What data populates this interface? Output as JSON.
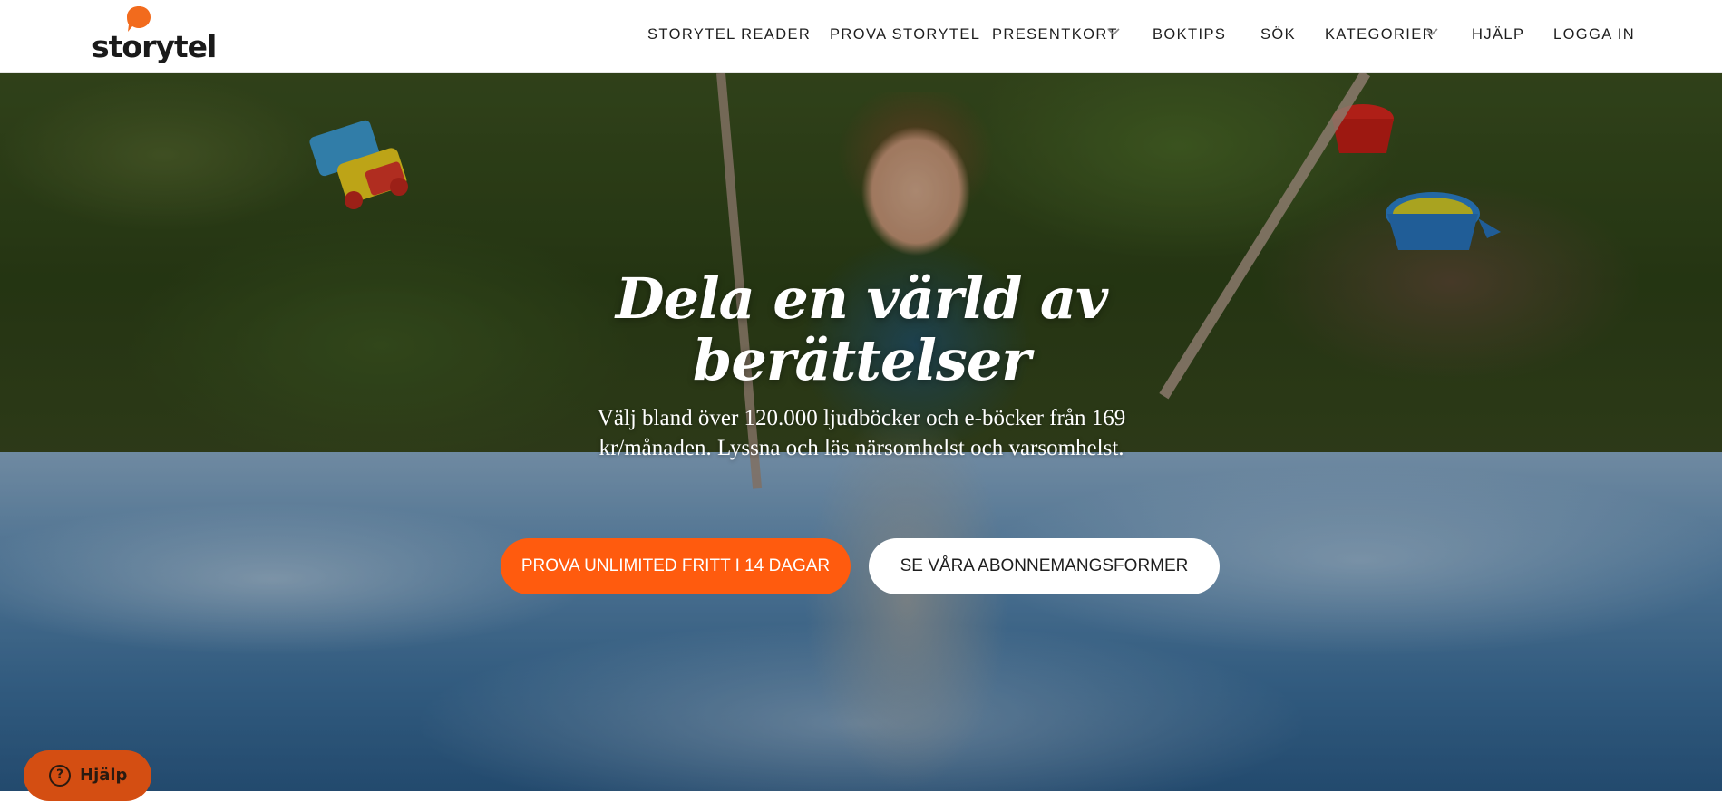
{
  "brand": {
    "name": "storytel",
    "accent": "#ff5b0e"
  },
  "nav": {
    "items": [
      {
        "label": "STORYTEL READER"
      },
      {
        "label": "PROVA STORYTEL"
      },
      {
        "label": "PRESENTKORT"
      },
      {
        "label": "BOKTIPS"
      },
      {
        "label": "SÖK"
      },
      {
        "label": "KATEGORIER"
      },
      {
        "label": "HJÄLP"
      },
      {
        "label": "LOGGA IN"
      }
    ]
  },
  "hero": {
    "title": "Dela en värld av berättelser",
    "subtitle": "Välj bland över 120.000 ljudböcker och e-böcker från 169 kr/månaden. Lyssna och läs närsomhelst och varsomhelst.",
    "primary_cta": "PROVA UNLIMITED FRITT I 14 DAGAR",
    "secondary_cta": "SE VÅRA ABONNEMANGSFORMER"
  },
  "help_widget": {
    "label": "Hjälp",
    "icon": "question-circle-icon"
  }
}
